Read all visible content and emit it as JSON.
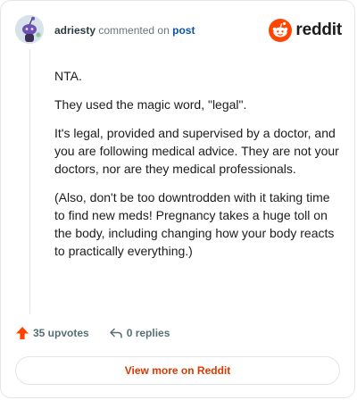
{
  "comment": {
    "username": "adriesty",
    "action_text": "commented on",
    "post_link": "post",
    "paragraphs": [
      "NTA.",
      "They used the magic word, \"legal\".",
      "It's legal, provided and supervised by a doctor, and you are following medical advice. They are not your doctors, nor are they medical professionals.",
      "(Also, don't be too downtrodden with it taking time to find new meds! Pregnancy takes a huge toll on the body, including changing how your body reacts to practically everything.)"
    ]
  },
  "brand": {
    "name": "reddit",
    "color": "#ff4500",
    "icon": "reddit-snoo-icon"
  },
  "actions": {
    "upvotes": "35 upvotes",
    "replies": "0 replies",
    "upvote_icon": "upvote-arrow-icon",
    "reply_icon": "reply-arrow-icon",
    "upvote_color": "#ff4500"
  },
  "view_more": {
    "label": "View more on Reddit",
    "color": "#d93a00"
  }
}
